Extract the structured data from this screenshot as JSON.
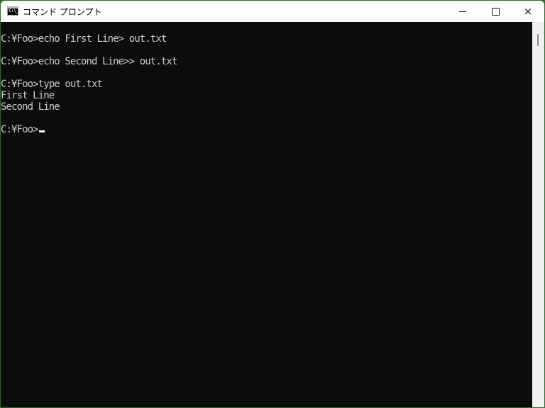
{
  "window": {
    "title": "コマンド プロンプト",
    "icon": "cmd-icon",
    "icon_text": "C:\\_",
    "controls": {
      "minimize": "minimize",
      "maximize": "maximize",
      "close": "×"
    },
    "border_color": "#2e6b2e"
  },
  "console": {
    "background": "#0c0c0c",
    "foreground": "#cccccc",
    "lines": [
      "C:¥Foo>echo First Line> out.txt",
      "",
      "C:¥Foo>echo Second Line>> out.txt",
      "",
      "C:¥Foo>type out.txt",
      "First Line",
      "Second Line",
      "",
      "C:¥Foo>"
    ]
  }
}
